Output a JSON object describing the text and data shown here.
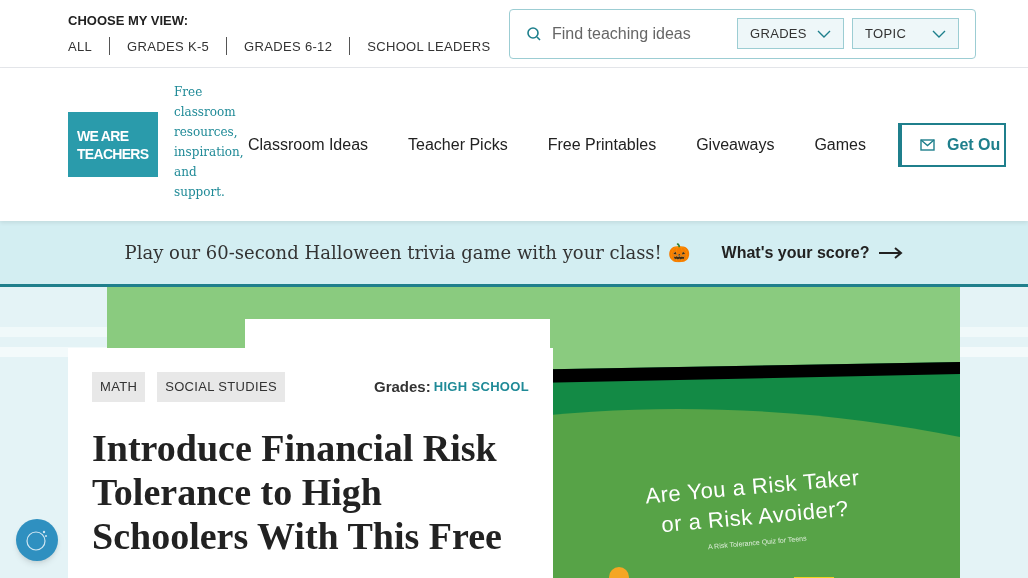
{
  "view_selector": {
    "label": "CHOOSE MY VIEW:",
    "options": [
      {
        "label": "ALL"
      },
      {
        "label": "GRADES K-5"
      },
      {
        "label": "GRADES 6-12"
      },
      {
        "label": "SCHOOL LEADERS"
      }
    ]
  },
  "search": {
    "placeholder": "Find teaching ideas",
    "filters": [
      "GRADES",
      "TOPIC"
    ]
  },
  "logo": {
    "lines": [
      "WE ARE",
      "TEACHERS"
    ],
    "tagline": "Free classroom resources, inspiration, and support."
  },
  "nav": [
    "Classroom Ideas",
    "Teacher Picks",
    "Free Printables",
    "Giveaways",
    "Games"
  ],
  "cta": "Get Ou",
  "banner": {
    "text": "Play our 60-second Halloween trivia game with your class! 🎃",
    "link": "What's your score?"
  },
  "article": {
    "tags": [
      "MATH",
      "SOCIAL STUDIES"
    ],
    "grades_label": "Grades:",
    "grades_value": "HIGH SCHOOL",
    "title": "Introduce Financial Risk Tolerance to High Schoolers With This Free"
  },
  "hero_image": {
    "title_lines": [
      "Are You a Risk Taker",
      "or a Risk Avoider?"
    ],
    "subtitle": "A Risk Tolerance Quiz for Teens"
  }
}
